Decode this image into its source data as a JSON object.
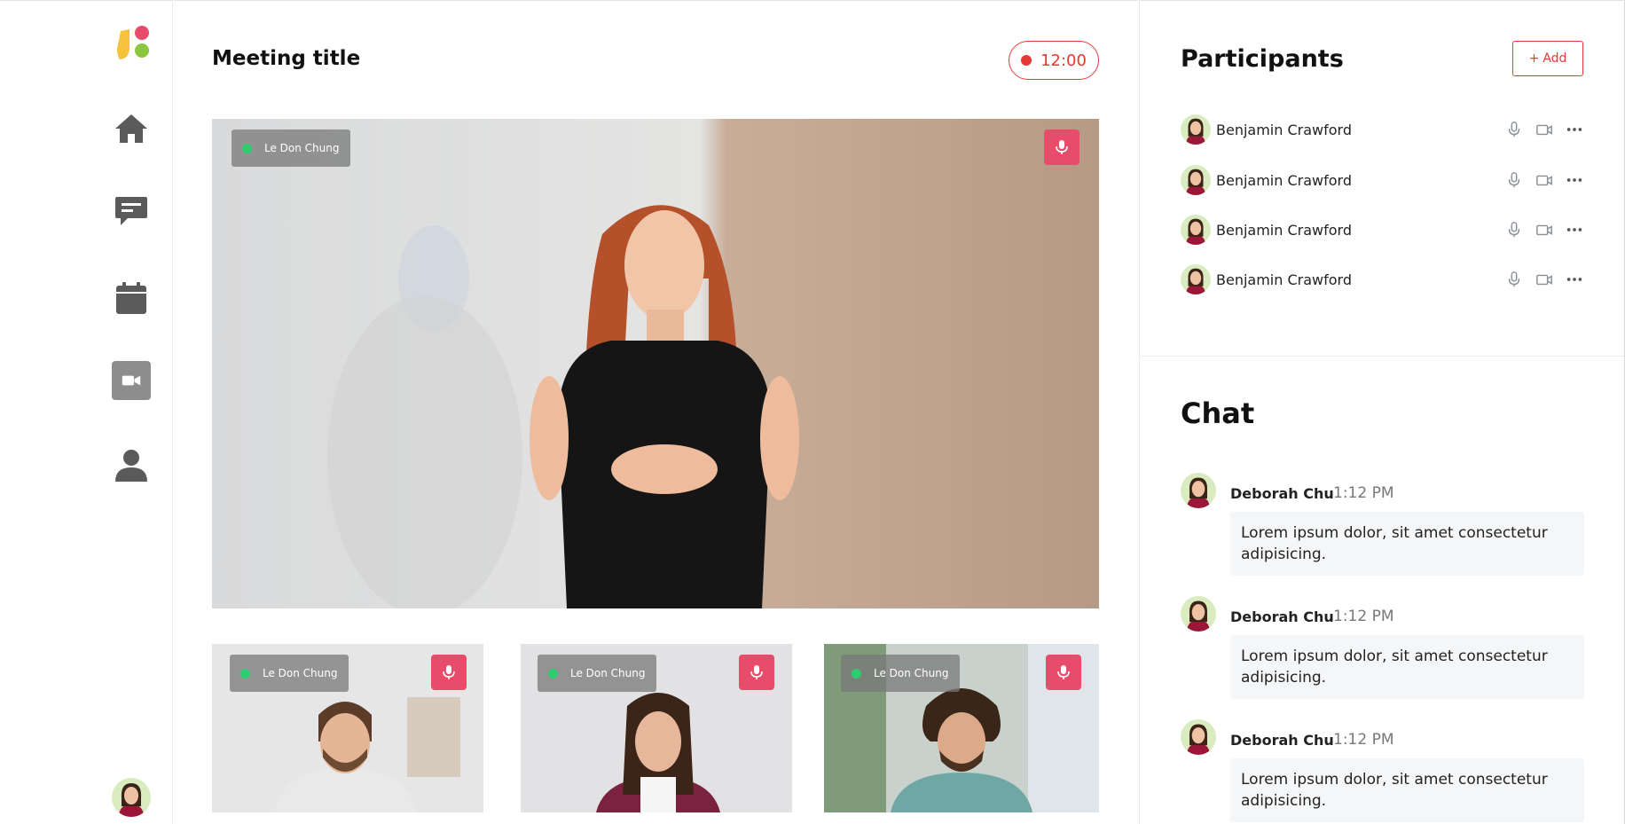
{
  "sidebar": {
    "nav": [
      {
        "icon": "home-icon",
        "active": false
      },
      {
        "icon": "chat-icon",
        "active": false
      },
      {
        "icon": "calendar-icon",
        "active": false
      },
      {
        "icon": "video-camera-icon",
        "active": true
      },
      {
        "icon": "user-icon",
        "active": false
      }
    ]
  },
  "meeting": {
    "title": "Meeting title",
    "timer": "12:00"
  },
  "videos": {
    "main": {
      "name": "Le Don Chung"
    },
    "thumbs": [
      {
        "name": "Le Don Chung"
      },
      {
        "name": "Le Don Chung"
      },
      {
        "name": "Le Don Chung"
      }
    ]
  },
  "participants": {
    "title": "Participants",
    "add_label": "Add",
    "items": [
      {
        "name": "Benjamin Crawford"
      },
      {
        "name": "Benjamin Crawford"
      },
      {
        "name": "Benjamin Crawford"
      },
      {
        "name": "Benjamin Crawford"
      }
    ]
  },
  "chat": {
    "title": "Chat",
    "messages": [
      {
        "author": "Deborah Chu",
        "time": "1:12 PM",
        "text": "Lorem ipsum dolor, sit amet consectetur adipisicing."
      },
      {
        "author": "Deborah Chu",
        "time": "1:12 PM",
        "text": "Lorem ipsum dolor, sit amet consectetur adipisicing."
      },
      {
        "author": "Deborah Chu",
        "time": "1:12 PM",
        "text": "Lorem ipsum dolor, sit amet consectetur adipisicing."
      }
    ]
  },
  "colors": {
    "accent": "#e53935",
    "mic_button": "#e84c6b",
    "online": "#2ecc71",
    "nav_icon": "#5a5a5a"
  }
}
